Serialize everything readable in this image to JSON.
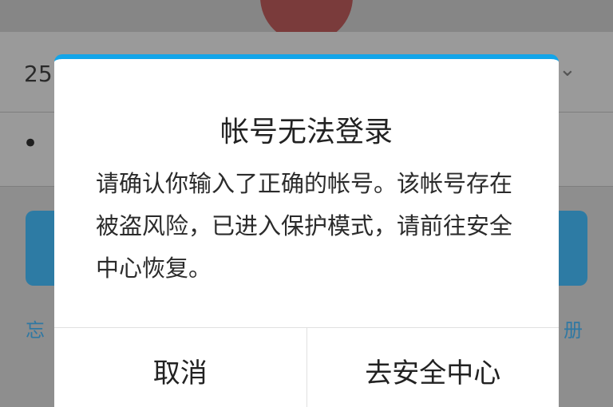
{
  "background": {
    "account_partial": "25",
    "password_dots": "• •",
    "dropdown_icon": "chevron-down",
    "link_left_partial": "忘",
    "link_right_partial": "册"
  },
  "dialog": {
    "title": "帐号无法登录",
    "message": "请确认你输入了正确的帐号。该帐号存在被盗风险，已进入保护模式，请前往安全中心恢复。",
    "cancel_label": "取消",
    "confirm_label": "去安全中心",
    "accent_color": "#12a5e9"
  }
}
